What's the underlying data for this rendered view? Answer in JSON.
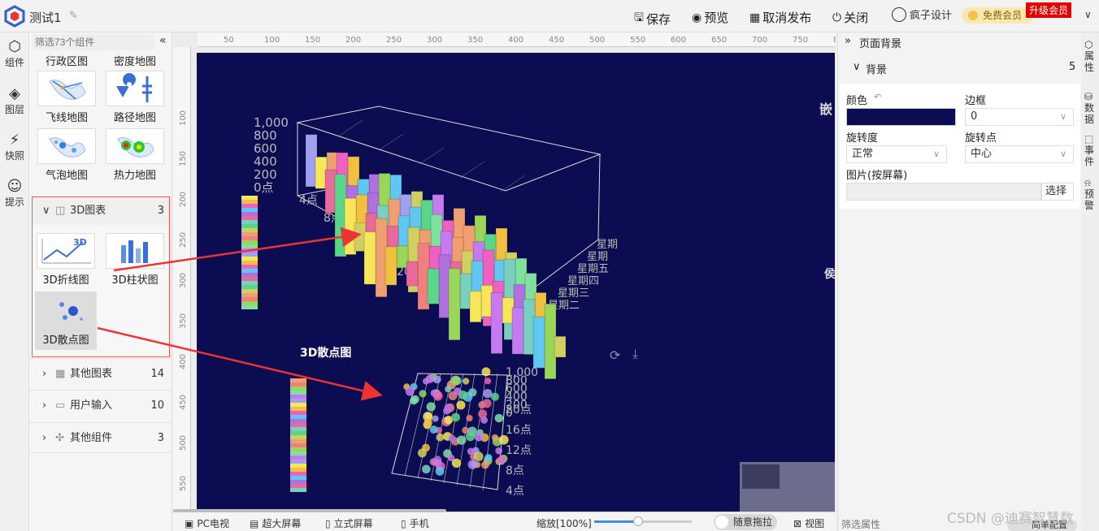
{
  "app": {
    "title": "测试1",
    "save": "保存",
    "preview": "预览",
    "unpublish": "取消发布",
    "close": "关闭",
    "user": "疯子设计",
    "vip": "免费会员",
    "upgrade": "升级会员"
  },
  "left_rail": [
    {
      "label": "组件",
      "icon": "cube-icon"
    },
    {
      "label": "图层",
      "icon": "layers-icon"
    },
    {
      "label": "快照",
      "icon": "snapshot-icon"
    },
    {
      "label": "提示",
      "icon": "bulb-icon"
    }
  ],
  "component_panel": {
    "filter_placeholder": "筛选73个组件",
    "items_top": [
      "行政区图",
      "密度地图",
      "飞线地图",
      "路径地图",
      "气泡地图",
      "热力地图"
    ],
    "group_3d": {
      "label": "3D图表",
      "count": "3",
      "items": [
        "3D折线图",
        "3D柱状图",
        "3D散点图"
      ]
    },
    "groups": [
      {
        "label": "其他图表",
        "count": "14"
      },
      {
        "label": "用户输入",
        "count": "10"
      },
      {
        "label": "其他组件",
        "count": "3"
      }
    ]
  },
  "ruler": {
    "top": [
      "50",
      "100",
      "150",
      "200",
      "250",
      "300",
      "350",
      "400",
      "450",
      "500",
      "550",
      "600",
      "650",
      "700",
      "750",
      "800"
    ],
    "left": [
      "100",
      "150",
      "200",
      "250",
      "300",
      "350",
      "400",
      "450",
      "500",
      "550"
    ]
  },
  "canvas": {
    "bar3d": {
      "ylabels": [
        "1,000",
        "800",
        "600",
        "400",
        "200",
        "0点"
      ],
      "xlabels": [
        "4点",
        "8点",
        "12点",
        "16点",
        "20点"
      ],
      "zlabels": [
        "星期",
        "星期",
        "星期五",
        "星期四",
        "星期三",
        "星期二"
      ]
    },
    "scatter_title": "3D散点图",
    "scatter3d": {
      "ylabels": [
        "1,000",
        "800",
        "600",
        "400",
        "200",
        "0"
      ],
      "zlabels": [
        "20点",
        "16点",
        "12点",
        "8点",
        "4点"
      ]
    },
    "right_edge_text": [
      "嵌",
      "侯"
    ]
  },
  "bottom": {
    "pc": "PC电视",
    "big": "超大屏幕",
    "vertical": "立式屏幕",
    "phone": "手机",
    "zoom": "缩放[100%]",
    "zoom_level": 0.45,
    "drag": "随意拖拉",
    "view": "视图"
  },
  "props": {
    "header": "页面背景",
    "section": "背景",
    "section_count": "5",
    "color_label": "颜色",
    "color_value": "#0b0c52",
    "border_label": "边框",
    "border_value": "0",
    "rotate_label": "旋转度",
    "rotate_value": "正常",
    "pivot_label": "旋转点",
    "pivot_value": "中心",
    "image_label": "图片(按屏幕)",
    "choose": "选择",
    "filter_placeholder": "筛选属性",
    "simple_config": "简单配置"
  },
  "right_rail": [
    "属性",
    "数据",
    "事件",
    "预警"
  ],
  "watermark": "CSDN @迪赛智慧数"
}
